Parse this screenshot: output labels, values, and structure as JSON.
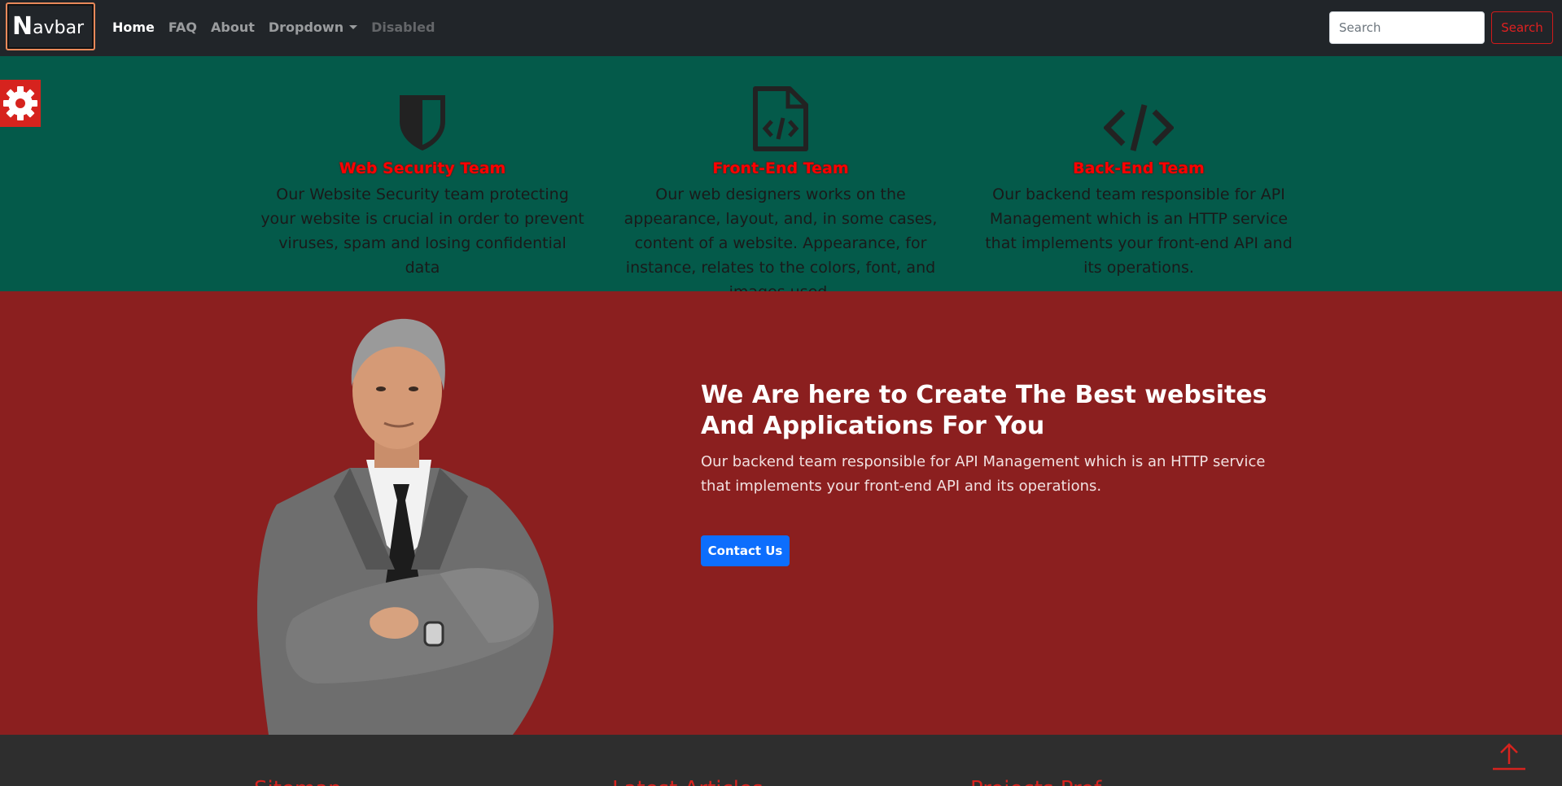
{
  "navbar": {
    "brand_initial": "N",
    "brand_rest": "avbar",
    "links": [
      {
        "label": "Home"
      },
      {
        "label": "FAQ"
      },
      {
        "label": "About"
      },
      {
        "label": "Dropdown"
      },
      {
        "label": "Disabled"
      }
    ],
    "search_placeholder": "Search",
    "search_button": "Search"
  },
  "services": [
    {
      "icon": "shield-icon",
      "title": "Web Security Team",
      "desc": "Our Website Security team protecting your website is crucial in order to prevent viruses, spam and losing confidential data"
    },
    {
      "icon": "file-code-icon",
      "title": "Front-End Team",
      "desc": "Our web designers works on the appearance, layout, and, in some cases, content of a website. Appearance, for instance, relates to the colors, font, and images used."
    },
    {
      "icon": "code-icon",
      "title": "Back-End Team",
      "desc": "Our backend team responsible for API Management which is an HTTP service that implements your front-end API and its operations."
    }
  ],
  "hero": {
    "title": "We Are here to Create The Best websites And Applications For You",
    "text": "Our backend team responsible for API Management which is an HTTP service that implements your front-end API and its operations.",
    "button": "Contact Us"
  },
  "footer": {
    "headings": [
      "Sitemap",
      "Latest Articles",
      "Projects Prof"
    ]
  },
  "colors": {
    "navbar_bg": "#212529",
    "services_bg": "#045a4a",
    "hero_bg": "#8b1f1f",
    "accent_red": "#d6231e",
    "primary_blue": "#0d6efd"
  }
}
